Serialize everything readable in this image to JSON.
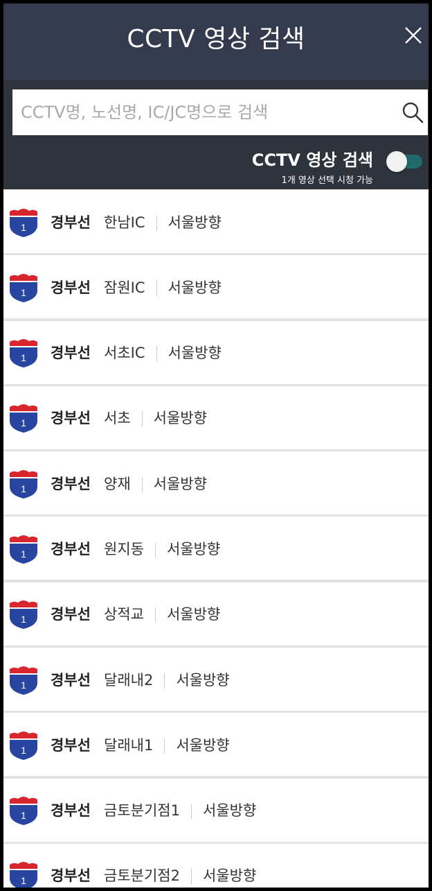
{
  "header": {
    "title": "CCTV 영상 검색"
  },
  "search": {
    "placeholder": "CCTV명, 노선명, IC/JC명으로 검색"
  },
  "toggle": {
    "label": "CCTV 영상 검색",
    "sublabel": "1개 영상 선택 시청 가능",
    "on": false
  },
  "colors": {
    "header_bg": "#353b4e",
    "panel_bg": "#2f333c",
    "shield_red": "#d7262d",
    "shield_blue": "#2846a0",
    "toggle_track": "#1f6a6b"
  },
  "list": {
    "items": [
      {
        "shield_number": "1",
        "route": "경부선",
        "name": "한남IC",
        "direction": "서울방향"
      },
      {
        "shield_number": "1",
        "route": "경부선",
        "name": "잠원IC",
        "direction": "서울방향"
      },
      {
        "shield_number": "1",
        "route": "경부선",
        "name": "서초IC",
        "direction": "서울방향"
      },
      {
        "shield_number": "1",
        "route": "경부선",
        "name": "서초",
        "direction": "서울방향"
      },
      {
        "shield_number": "1",
        "route": "경부선",
        "name": "양재",
        "direction": "서울방향"
      },
      {
        "shield_number": "1",
        "route": "경부선",
        "name": "원지동",
        "direction": "서울방향"
      },
      {
        "shield_number": "1",
        "route": "경부선",
        "name": "상적교",
        "direction": "서울방향"
      },
      {
        "shield_number": "1",
        "route": "경부선",
        "name": "달래내2",
        "direction": "서울방향"
      },
      {
        "shield_number": "1",
        "route": "경부선",
        "name": "달래내1",
        "direction": "서울방향"
      },
      {
        "shield_number": "1",
        "route": "경부선",
        "name": "금토분기점1",
        "direction": "서울방향"
      },
      {
        "shield_number": "1",
        "route": "경부선",
        "name": "금토분기점2",
        "direction": "서울방향"
      }
    ]
  }
}
